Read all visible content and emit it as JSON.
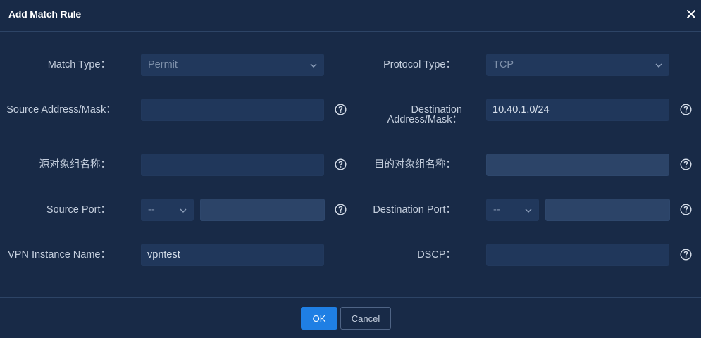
{
  "dialog": {
    "title": "Add Match Rule"
  },
  "form": {
    "match_type": {
      "label": "Match Type：",
      "value": "Permit"
    },
    "protocol_type": {
      "label": "Protocol Type：",
      "value": "TCP"
    },
    "source_address_mask": {
      "label": "Source Address/Mask：",
      "value": ""
    },
    "destination_address_mask": {
      "label": "Destination Address/Mask：",
      "value": "10.40.1.0/24"
    },
    "source_object_group": {
      "label": "源对象组名称：",
      "value": ""
    },
    "destination_object_group": {
      "label": "目的对象组名称：",
      "value": ""
    },
    "source_port": {
      "label": "Source Port：",
      "operator": "--",
      "value": ""
    },
    "destination_port": {
      "label": "Destination Port：",
      "operator": "--",
      "value": ""
    },
    "vpn_instance_name": {
      "label": "VPN Instance Name：",
      "value": "vpntest"
    },
    "dscp": {
      "label": "DSCP：",
      "value": ""
    }
  },
  "footer": {
    "ok_label": "OK",
    "cancel_label": "Cancel"
  },
  "icons": {
    "close": "close-icon",
    "help": "question-circle-icon",
    "chevron": "chevron-down-icon"
  },
  "colors": {
    "background": "#182a47",
    "field": "#20375b",
    "field_disabled": "#2c4468",
    "primary": "#1f7fe4",
    "text": "#c4cedd"
  }
}
